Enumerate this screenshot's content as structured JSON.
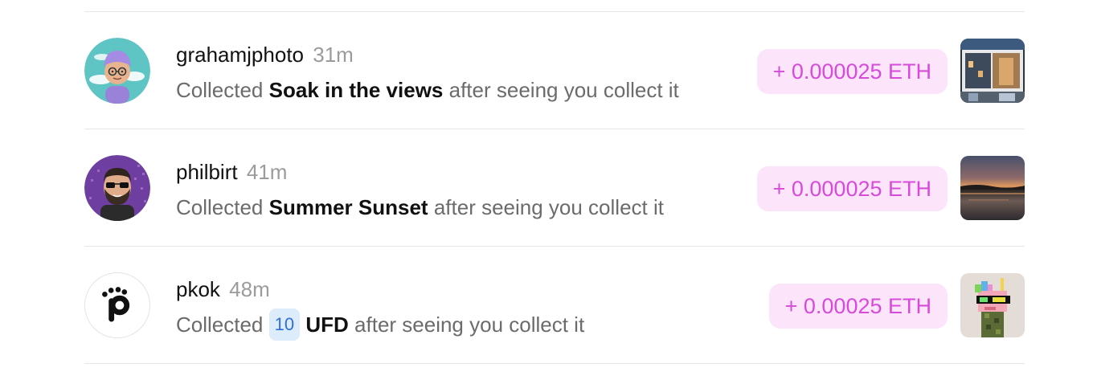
{
  "feed": {
    "items": [
      {
        "username": "grahamjphoto",
        "time": "31m",
        "prefix": "Collected",
        "quantity": "",
        "item_name": "Soak in the views",
        "suffix": "after seeing you collect it",
        "amount": "+ 0.000025 ETH",
        "avatar_icon": "memoji-avatar-icon",
        "thumbnail_icon": "city-photo-thumbnail"
      },
      {
        "username": "philbirt",
        "time": "41m",
        "prefix": "Collected",
        "quantity": "",
        "item_name": "Summer Sunset",
        "suffix": "after seeing you collect it",
        "amount": "+ 0.000025 ETH",
        "avatar_icon": "bearded-man-avatar-icon",
        "thumbnail_icon": "sunset-photo-thumbnail"
      },
      {
        "username": "pkok",
        "time": "48m",
        "prefix": "Collected",
        "quantity": "10",
        "item_name": "UFD",
        "suffix": "after seeing you collect it",
        "amount": "+ 0.00025 ETH",
        "avatar_icon": "p-logo-avatar-icon",
        "thumbnail_icon": "pixel-unicorn-thumbnail"
      }
    ]
  },
  "colors": {
    "eth_text": "#d64bd9",
    "eth_bg": "#fce4fb",
    "badge_bg": "#dcecfb",
    "badge_text": "#2f6fd6",
    "muted_text": "#6b6b6b",
    "time_text": "#9b9b9b"
  }
}
